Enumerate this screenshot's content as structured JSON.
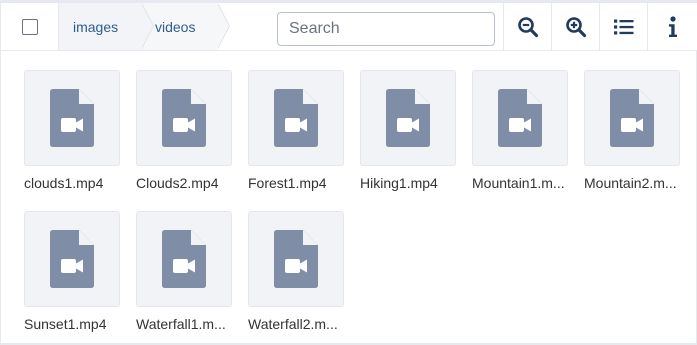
{
  "toolbar": {
    "breadcrumb": [
      {
        "label": "images"
      },
      {
        "label": "videos"
      }
    ],
    "search": {
      "placeholder": "Search",
      "value": ""
    },
    "buttons": {
      "zoom_out_icon": "zoom-out-icon",
      "zoom_in_icon": "zoom-in-icon",
      "list_view_icon": "list-view-icon",
      "info_icon": "info-icon"
    }
  },
  "files": [
    {
      "name": "clouds1.mp4",
      "icon": "video-file-icon"
    },
    {
      "name": "Clouds2.mp4",
      "icon": "video-file-icon"
    },
    {
      "name": "Forest1.mp4",
      "icon": "video-file-icon"
    },
    {
      "name": "Hiking1.mp4",
      "icon": "video-file-icon"
    },
    {
      "name": "Mountain1.m...",
      "icon": "video-file-icon"
    },
    {
      "name": "Mountain2.m...",
      "icon": "video-file-icon"
    },
    {
      "name": "Sunset1.mp4",
      "icon": "video-file-icon"
    },
    {
      "name": "Waterfall1.m...",
      "icon": "video-file-icon"
    },
    {
      "name": "Waterfall2.m...",
      "icon": "video-file-icon"
    }
  ],
  "colors": {
    "accent": "#2f5c8f",
    "icon": "#1f3b5e",
    "file_icon": "#7f8da6",
    "thumb_bg": "#f1f3f6"
  }
}
